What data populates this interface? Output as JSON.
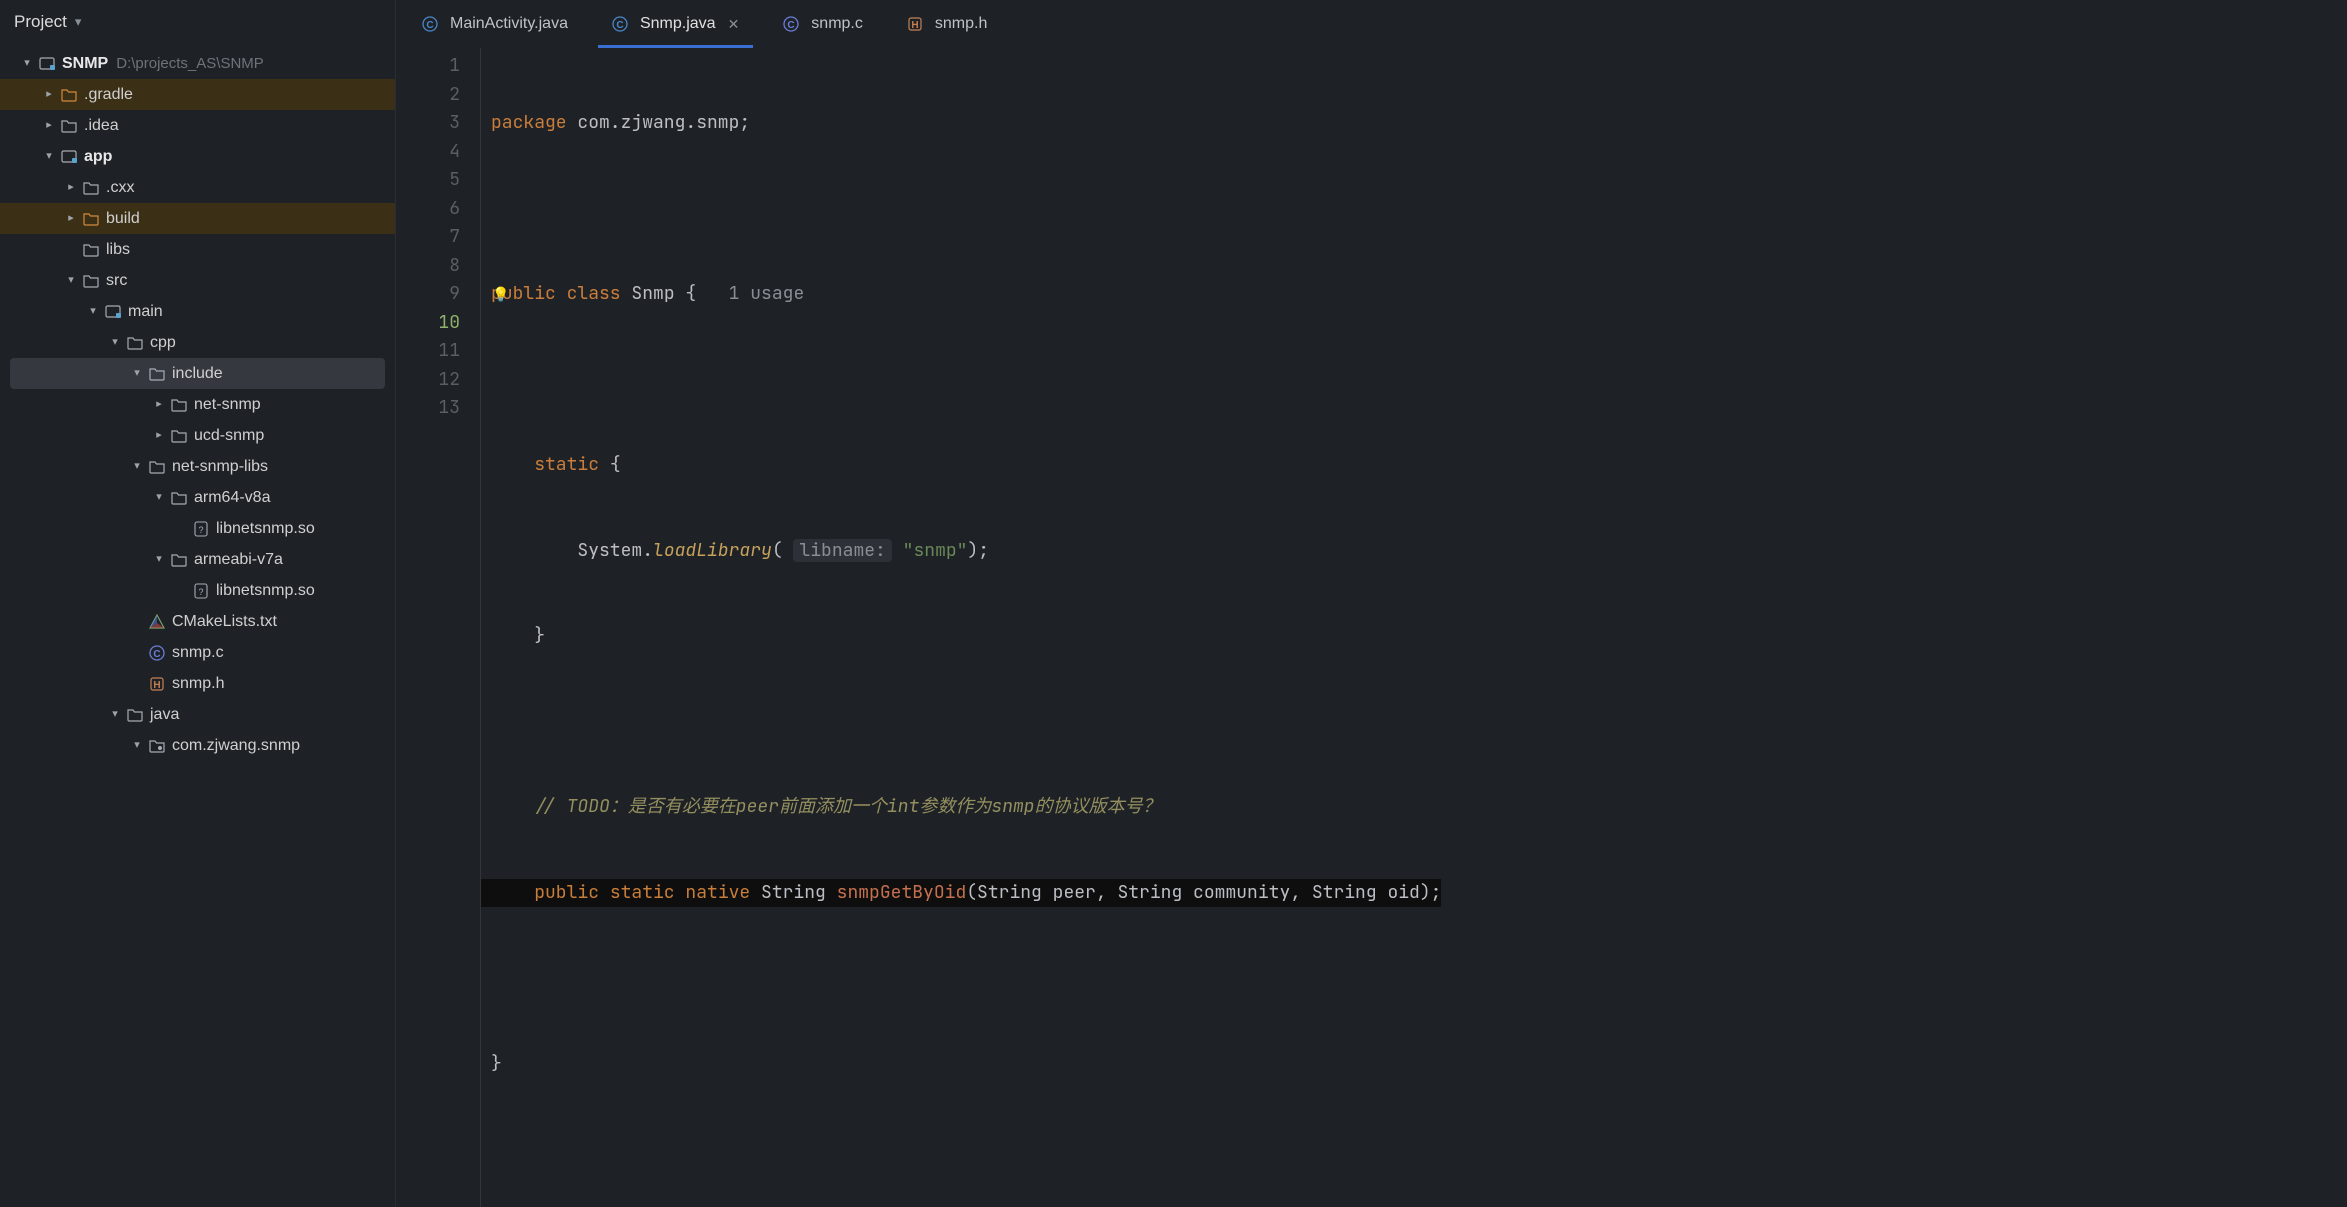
{
  "sidebar": {
    "title": "Project",
    "root": {
      "name": "SNMP",
      "path": "D:\\projects_AS\\SNMP"
    },
    "items": [
      {
        "label": ".gradle"
      },
      {
        "label": ".idea"
      },
      {
        "label": "app"
      },
      {
        "label": ".cxx"
      },
      {
        "label": "build"
      },
      {
        "label": "libs"
      },
      {
        "label": "src"
      },
      {
        "label": "main"
      },
      {
        "label": "cpp"
      },
      {
        "label": "include"
      },
      {
        "label": "net-snmp"
      },
      {
        "label": "ucd-snmp"
      },
      {
        "label": "net-snmp-libs"
      },
      {
        "label": "arm64-v8a"
      },
      {
        "label": "libnetsnmp.so"
      },
      {
        "label": "armeabi-v7a"
      },
      {
        "label": "libnetsnmp.so"
      },
      {
        "label": "CMakeLists.txt"
      },
      {
        "label": "snmp.c"
      },
      {
        "label": "snmp.h"
      },
      {
        "label": "java"
      },
      {
        "label": "com.zjwang.snmp"
      }
    ]
  },
  "tabs": [
    {
      "label": "MainActivity.java"
    },
    {
      "label": "Snmp.java"
    },
    {
      "label": "snmp.c"
    },
    {
      "label": "snmp.h"
    }
  ],
  "editor": {
    "line_numbers": [
      "1",
      "2",
      "3",
      "4",
      "5",
      "6",
      "7",
      "8",
      "9",
      "10",
      "11",
      "12",
      "13"
    ],
    "code": {
      "l1_pkg_kw": "package",
      "l1_pkg_name": " com.zjwang.snmp;",
      "l3_pub": "public ",
      "l3_cls": "class ",
      "l3_name": "Snmp",
      "l3_brace": " {",
      "l3_usages": "1 usage",
      "l5_static": "static",
      "l5_brace": " {",
      "l6_call1": "System.",
      "l6_call2": "loadLibrary",
      "l6_open": "(",
      "l6_hint": "libname:",
      "l6_str": "\"snmp\"",
      "l6_close": ");",
      "l7_close": "}",
      "l9_cmt": "// TODO：是否有必要在peer前面添加一个int参数作为snmp的协议版本号？",
      "l10_pub": "public ",
      "l10_static": "static ",
      "l10_native": "native",
      "l10_type": " String ",
      "l10_fn": "snmpGetByOid",
      "l10_args": "(String peer, String community, String oid);",
      "l12_close": "}"
    }
  }
}
